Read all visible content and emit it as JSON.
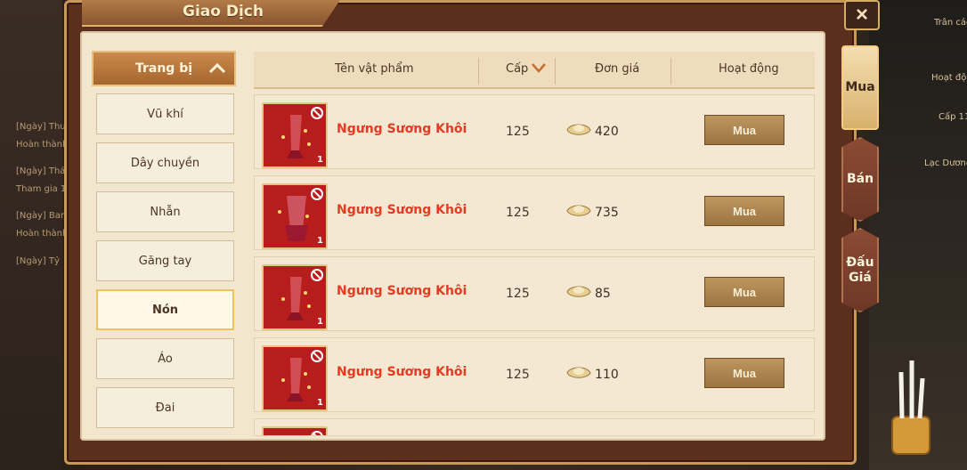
{
  "app": {
    "title": "Giao Dịch"
  },
  "background": {
    "left_texts": [
      "[Ngày] Thu",
      "Hoàn thành",
      "[Ngày] Thá",
      "Tham gia 1",
      "[Ngày] Ban",
      "Hoàn thành",
      "[Ngày] Tỷ"
    ],
    "right_texts": [
      "Trân các",
      "Hoạt độn",
      "Lạc Dương",
      "Cấp 11"
    ]
  },
  "sidebar": {
    "header": "Trang bị",
    "items": [
      {
        "label": "Vũ khí",
        "active": false
      },
      {
        "label": "Dây chuyền",
        "active": false
      },
      {
        "label": "Nhẫn",
        "active": false
      },
      {
        "label": "Găng tay",
        "active": false
      },
      {
        "label": "Nón",
        "active": true
      },
      {
        "label": "Áo",
        "active": false
      },
      {
        "label": "Đai",
        "active": false
      }
    ]
  },
  "table": {
    "headers": {
      "name": "Tên vật phẩm",
      "level": "Cấp",
      "price": "Đơn giá",
      "action": "Hoạt động"
    },
    "rows": [
      {
        "name": "Ngưng Sương Khôi",
        "level": "125",
        "price": "420",
        "button": "Mua",
        "quantity": "1"
      },
      {
        "name": "Ngưng Sương Khôi",
        "level": "125",
        "price": "735",
        "button": "Mua",
        "quantity": "1"
      },
      {
        "name": "Ngưng Sương Khôi",
        "level": "125",
        "price": "85",
        "button": "Mua",
        "quantity": "1"
      },
      {
        "name": "Ngưng Sương Khôi",
        "level": "125",
        "price": "110",
        "button": "Mua",
        "quantity": "1"
      }
    ]
  },
  "right_tabs": [
    {
      "label": "Mua",
      "active": true
    },
    {
      "label": "Bán",
      "active": false
    },
    {
      "label": "Đấu Giá",
      "active": false
    }
  ],
  "colors": {
    "item_name": "#e63a23",
    "panel": "#f3e6cf",
    "frame": "#5a2f1e",
    "accent": "#d8b06c"
  }
}
